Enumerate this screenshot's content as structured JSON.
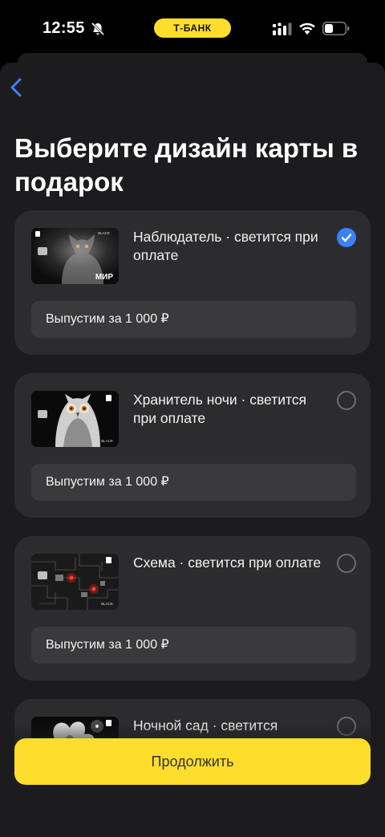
{
  "status_bar": {
    "time": "12:55",
    "bank_pill": "Т-БАНК",
    "icons": [
      "bell-slash-icon",
      "signal-icon",
      "wifi-icon",
      "battery-icon"
    ]
  },
  "header": {
    "back_icon": "chevron-left-icon",
    "title": "Выберите дизайн карты в подарок"
  },
  "cards": [
    {
      "title": "Наблюдатель · светится при оплате",
      "issue_label": "Выпустим за 1 000 ₽",
      "selected": true,
      "card_text": [
        "BLACK",
        "МИР"
      ]
    },
    {
      "title": "Хранитель ночи · светится при оплате",
      "issue_label": "Выпустим за 1 000 ₽",
      "selected": false,
      "card_text": [
        "BLACK"
      ]
    },
    {
      "title": "Схема · светится при оплате",
      "issue_label": "Выпустим за 1 000 ₽",
      "selected": false,
      "card_text": [
        "BLACK"
      ]
    },
    {
      "title": "Ночной сад · светится",
      "issue_label": "",
      "selected": false,
      "card_text": []
    }
  ],
  "continue_button": {
    "label": "Продолжить"
  },
  "colors": {
    "accent_yellow": "#ffdd2d",
    "accent_blue": "#3a82f7",
    "sheet_bg": "#1c1c1e",
    "card_bg": "#2c2c2e",
    "issue_bg": "#3a3a3c"
  }
}
